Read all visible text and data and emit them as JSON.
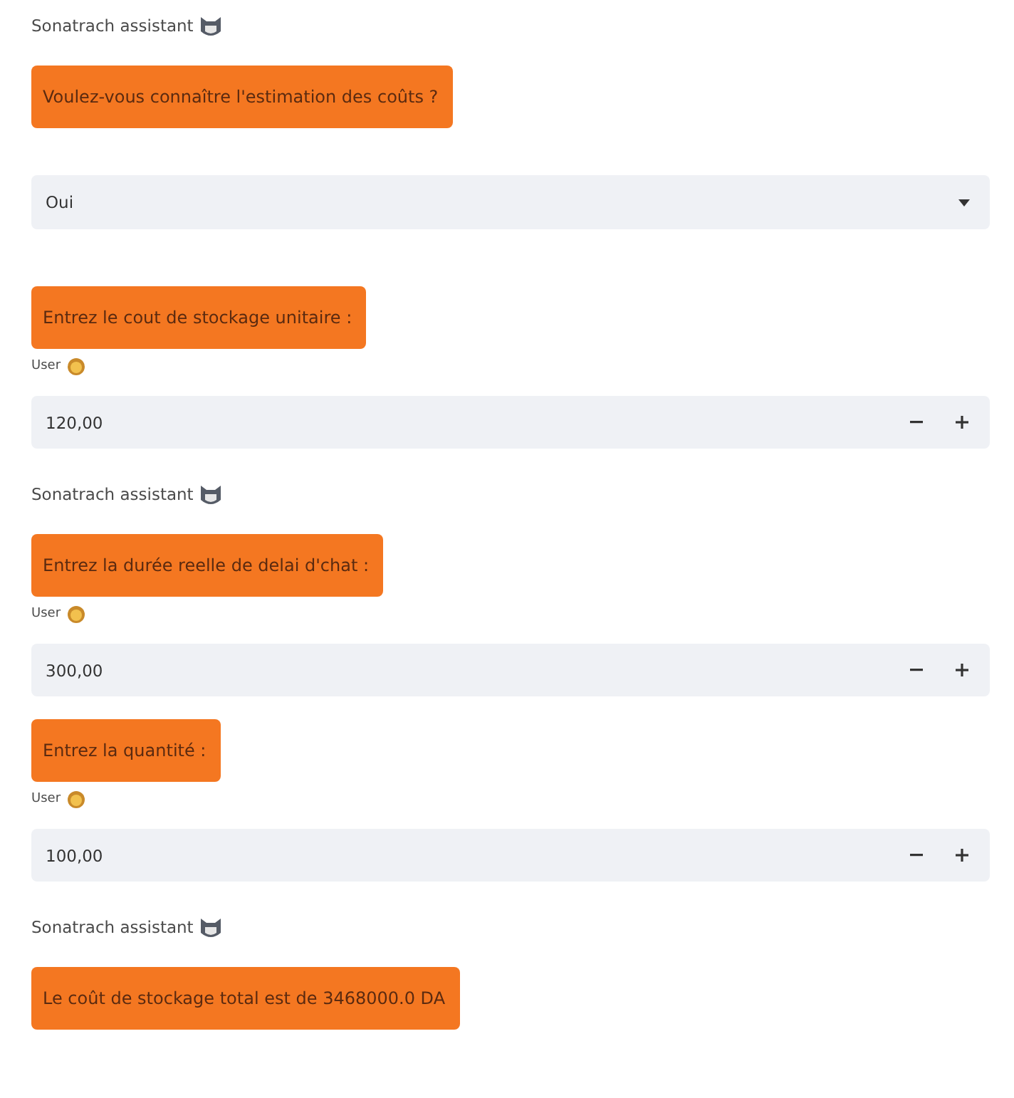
{
  "chat": [
    {
      "kind": "assistant",
      "label": "Sonatrach assistant"
    },
    {
      "kind": "message",
      "text": "Voulez-vous connaître l'estimation des coûts ?"
    },
    {
      "kind": "select",
      "value": "Oui"
    },
    {
      "kind": "message",
      "text": "Entrez le cout de stockage unitaire :"
    },
    {
      "kind": "user",
      "label": "User"
    },
    {
      "kind": "number",
      "value": "120,00"
    },
    {
      "kind": "assistant",
      "label": "Sonatrach assistant"
    },
    {
      "kind": "message",
      "text": "Entrez la durée reelle de delai d'chat :"
    },
    {
      "kind": "user",
      "label": "User"
    },
    {
      "kind": "number",
      "value": "300,00"
    },
    {
      "kind": "message",
      "text": "Entrez la quantité :"
    },
    {
      "kind": "user",
      "label": "User"
    },
    {
      "kind": "number",
      "value": "100,00"
    },
    {
      "kind": "assistant",
      "label": "Sonatrach assistant"
    },
    {
      "kind": "message",
      "text": "Le coût de stockage total est de 3468000.0 DA"
    }
  ]
}
